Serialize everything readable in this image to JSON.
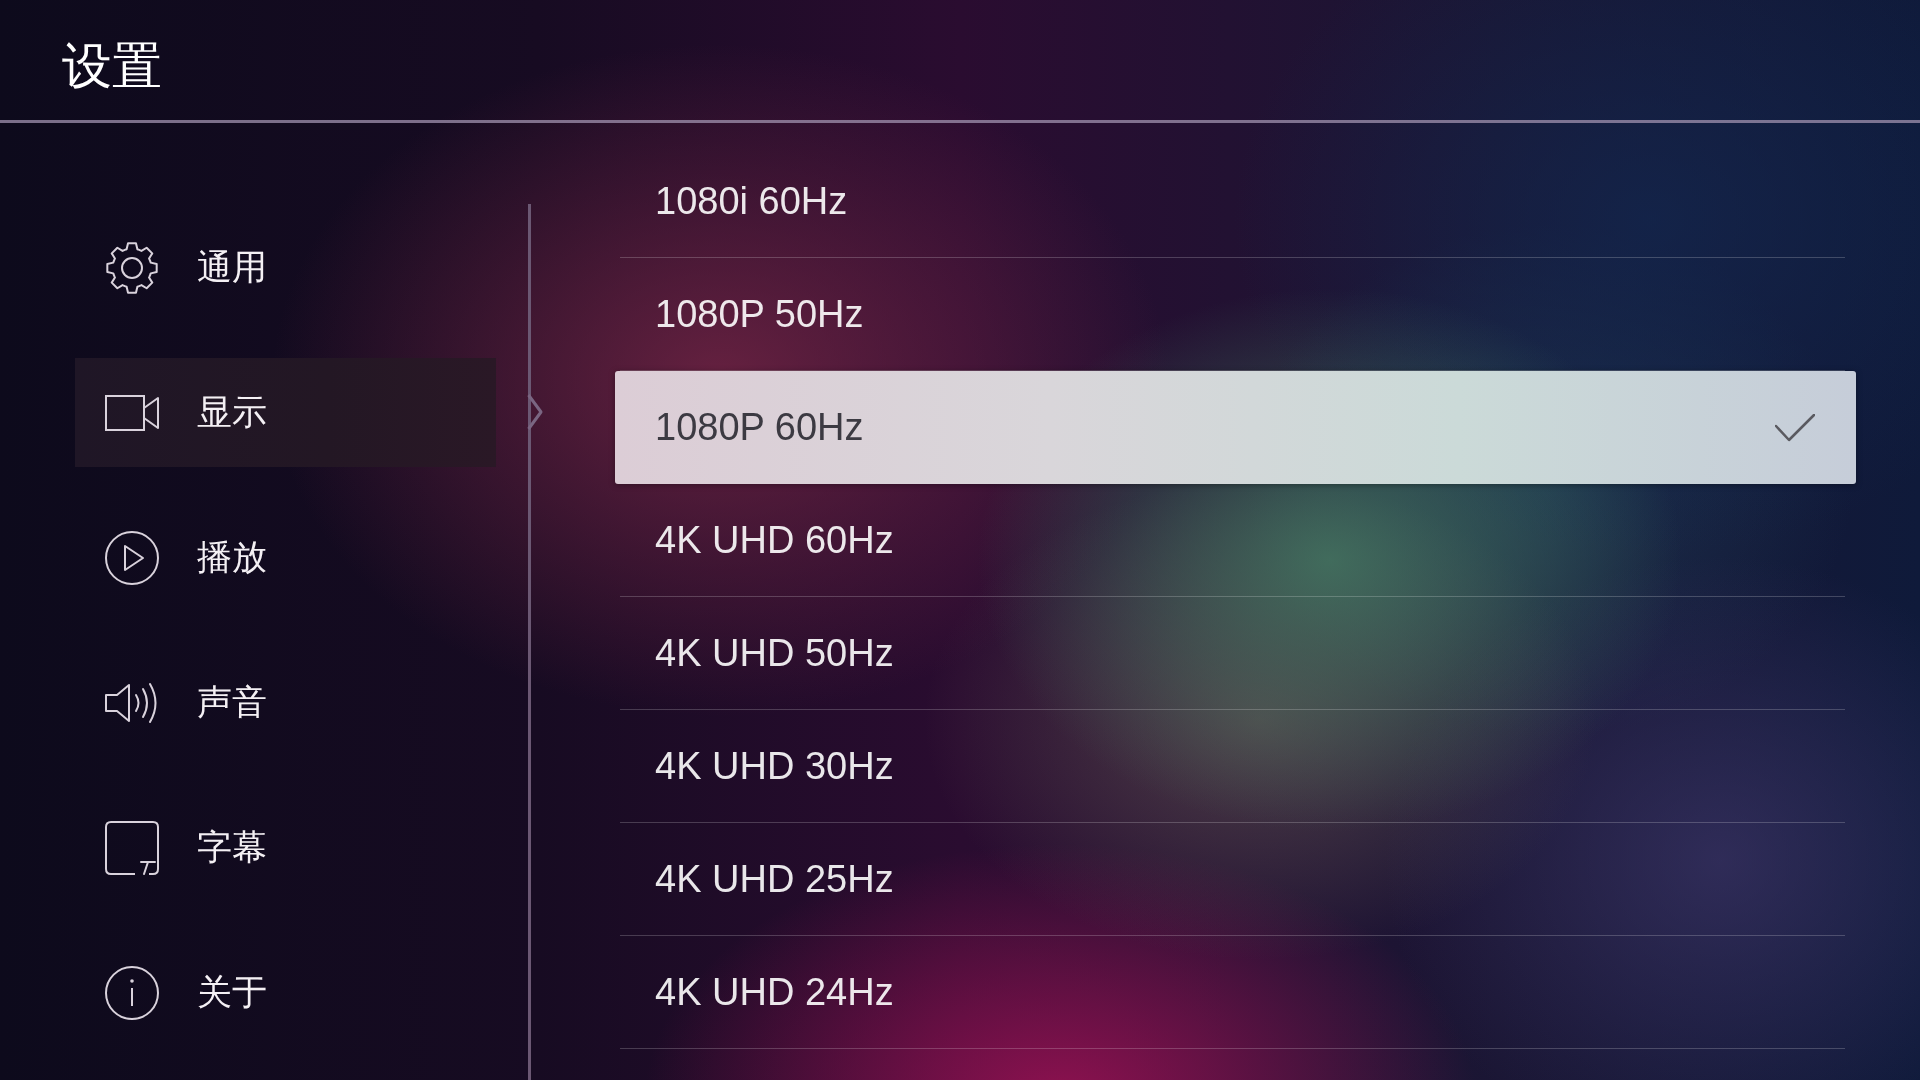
{
  "header": {
    "title": "设置"
  },
  "sidebar": {
    "items": [
      {
        "label": "通用",
        "kind": "gear",
        "selected": false
      },
      {
        "label": "显示",
        "kind": "camera",
        "selected": true
      },
      {
        "label": "播放",
        "kind": "play",
        "selected": false
      },
      {
        "label": "声音",
        "kind": "speaker",
        "selected": false
      },
      {
        "label": "字幕",
        "kind": "subtitles",
        "selected": false
      },
      {
        "label": "关于",
        "kind": "info",
        "selected": false
      }
    ]
  },
  "options": [
    {
      "label": "1080i 60Hz",
      "selected": false
    },
    {
      "label": "1080P 50Hz",
      "selected": false
    },
    {
      "label": "1080P 60Hz",
      "selected": true
    },
    {
      "label": "4K UHD 60Hz",
      "selected": false
    },
    {
      "label": "4K UHD 50Hz",
      "selected": false
    },
    {
      "label": "4K UHD 30Hz",
      "selected": false
    },
    {
      "label": "4K UHD 25Hz",
      "selected": false
    },
    {
      "label": "4K UHD 24Hz",
      "selected": false
    }
  ]
}
